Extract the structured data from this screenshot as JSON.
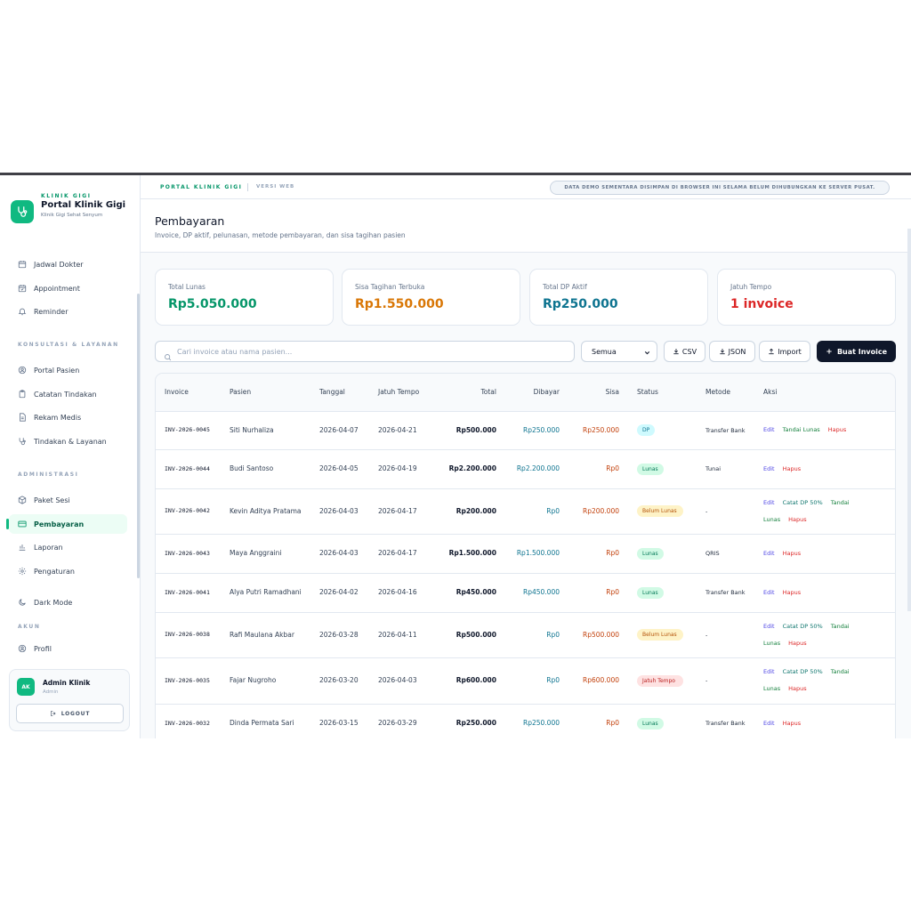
{
  "brand": {
    "kicker": "KLINIK GIGI",
    "title": "Portal Klinik Gigi",
    "subtitle": "Klinik Gigi Sehat Senyum"
  },
  "topbar": {
    "brand": "PORTAL KLINIK GIGI",
    "version": "VERSI WEB",
    "notice": "DATA DEMO SEMENTARA DISIMPAN DI BROWSER INI SELAMA BELUM DIHUBUNGKAN KE SERVER PUSAT."
  },
  "sidebar": {
    "items_top": [
      {
        "label": "Jadwal Dokter",
        "icon": "calendar-icon"
      },
      {
        "label": "Appointment",
        "icon": "calendar-check-icon"
      },
      {
        "label": "Reminder",
        "icon": "bell-icon"
      }
    ],
    "section_consult": "KONSULTASI & LAYANAN",
    "items_consult": [
      {
        "label": "Portal Pasien",
        "icon": "user-circle-icon"
      },
      {
        "label": "Catatan Tindakan",
        "icon": "clipboard-icon"
      },
      {
        "label": "Rekam Medis",
        "icon": "file-text-icon"
      },
      {
        "label": "Tindakan & Layanan",
        "icon": "stethoscope-icon"
      }
    ],
    "section_admin": "ADMINISTRASI",
    "items_admin": [
      {
        "label": "Paket Sesi",
        "icon": "package-icon"
      },
      {
        "label": "Pembayaran",
        "icon": "credit-card-icon",
        "active": true
      },
      {
        "label": "Laporan",
        "icon": "bar-chart-icon"
      },
      {
        "label": "Pengaturan",
        "icon": "gear-icon"
      }
    ],
    "dark_mode": "Dark Mode",
    "section_account": "AKUN",
    "profile": "Profil"
  },
  "user": {
    "initials": "AK",
    "name": "Admin Klinik",
    "role": "Admin",
    "logout": "LOGOUT"
  },
  "page": {
    "title": "Pembayaran",
    "subtitle": "Invoice, DP aktif, pelunasan, metode pembayaran, dan sisa tagihan pasien"
  },
  "stats": [
    {
      "label": "Total Lunas",
      "value": "Rp5.050.000",
      "color": "#059669"
    },
    {
      "label": "Sisa Tagihan Terbuka",
      "value": "Rp1.550.000",
      "color": "#d97706"
    },
    {
      "label": "Total DP Aktif",
      "value": "Rp250.000",
      "color": "#0e7490"
    },
    {
      "label": "Jatuh Tempo",
      "value": "1 invoice",
      "color": "#dc2626"
    }
  ],
  "toolbar": {
    "search_placeholder": "Cari invoice atau nama pasien...",
    "filter_value": "Semua",
    "csv": "CSV",
    "json": "JSON",
    "import": "Import",
    "create": "Buat Invoice"
  },
  "table": {
    "headers": {
      "invoice": "Invoice",
      "patient": "Pasien",
      "date": "Tanggal",
      "due": "Jatuh Tempo",
      "total": "Total",
      "paid": "Dibayar",
      "rest": "Sisa",
      "status": "Status",
      "method": "Metode",
      "actions": "Aksi"
    },
    "actions": {
      "edit": "Edit",
      "dp": "Catat DP 50%",
      "lunas": "Tandai Lunas",
      "delete": "Hapus"
    },
    "rows": [
      {
        "invoice": "INV-2026-0045",
        "patient": "Siti Nurhaliza",
        "date": "2026-04-07",
        "due": "2026-04-21",
        "total": "Rp500.000",
        "paid": "Rp250.000",
        "rest": "Rp250.000",
        "status": "DP",
        "status_kind": "dp",
        "method": "Transfer Bank"
      },
      {
        "invoice": "INV-2026-0044",
        "patient": "Budi Santoso",
        "date": "2026-04-05",
        "due": "2026-04-19",
        "total": "Rp2.200.000",
        "paid": "Rp2.200.000",
        "rest": "Rp0",
        "status": "Lunas",
        "status_kind": "lunas",
        "method": "Tunai"
      },
      {
        "invoice": "INV-2026-0042",
        "patient": "Kevin Aditya Pratama",
        "date": "2026-04-03",
        "due": "2026-04-17",
        "total": "Rp200.000",
        "paid": "Rp0",
        "rest": "Rp200.000",
        "status": "Belum Lunas",
        "status_kind": "belum",
        "method": "-"
      },
      {
        "invoice": "INV-2026-0043",
        "patient": "Maya Anggraini",
        "date": "2026-04-03",
        "due": "2026-04-17",
        "total": "Rp1.500.000",
        "paid": "Rp1.500.000",
        "rest": "Rp0",
        "status": "Lunas",
        "status_kind": "lunas",
        "method": "QRIS"
      },
      {
        "invoice": "INV-2026-0041",
        "patient": "Alya Putri Ramadhani",
        "date": "2026-04-02",
        "due": "2026-04-16",
        "total": "Rp450.000",
        "paid": "Rp450.000",
        "rest": "Rp0",
        "status": "Lunas",
        "status_kind": "lunas",
        "method": "Transfer Bank"
      },
      {
        "invoice": "INV-2026-0038",
        "patient": "Rafi Maulana Akbar",
        "date": "2026-03-28",
        "due": "2026-04-11",
        "total": "Rp500.000",
        "paid": "Rp0",
        "rest": "Rp500.000",
        "status": "Belum Lunas",
        "status_kind": "belum",
        "method": "-"
      },
      {
        "invoice": "INV-2026-0035",
        "patient": "Fajar Nugroho",
        "date": "2026-03-20",
        "due": "2026-04-03",
        "total": "Rp600.000",
        "paid": "Rp0",
        "rest": "Rp600.000",
        "status": "Jatuh Tempo",
        "status_kind": "jatuh",
        "method": "-"
      },
      {
        "invoice": "INV-2026-0032",
        "patient": "Dinda Permata Sari",
        "date": "2026-03-15",
        "due": "2026-03-29",
        "total": "Rp250.000",
        "paid": "Rp250.000",
        "rest": "Rp0",
        "status": "Lunas",
        "status_kind": "lunas",
        "method": "Transfer Bank"
      }
    ]
  },
  "colors": {
    "accent": "#10b981",
    "primary_button": "#0f172a",
    "badge_dp_bg": "#cffafe",
    "badge_lunas_bg": "#d1fae5",
    "badge_belum_bg": "#fef3c7",
    "badge_jatuh_bg": "#fee2e2"
  }
}
